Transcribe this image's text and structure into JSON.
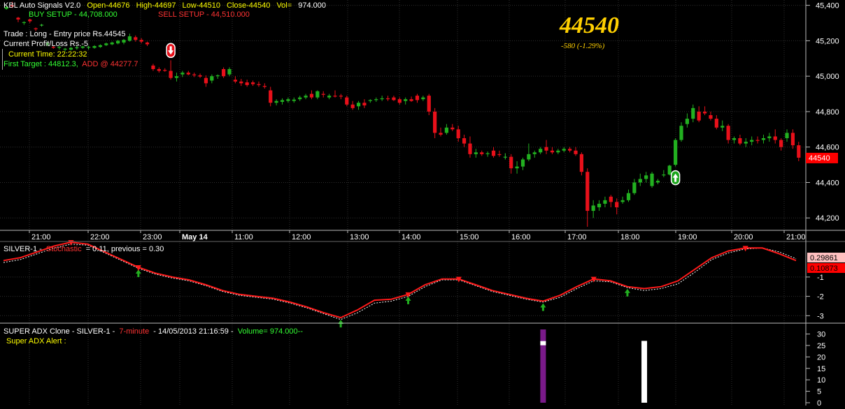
{
  "colors": {
    "background": "#000000",
    "grid": "#2e2e2e",
    "up": "#22b020",
    "down": "#e8101a",
    "doji": "#33cc33",
    "signal_line": "#ff1a1a",
    "stoch_dotted": "#ffffff",
    "title_white": "#ffffff",
    "open_yellow": "#ffff00",
    "buy_green": "#33ff33",
    "sell_red": "#ff3333",
    "big_price": "#ffd000",
    "change_text": "#ffd000",
    "last_price_box": "#ff0000",
    "adx_bar_purple": "#7a1a8a",
    "adx_bar_white": "#ffffff"
  },
  "price_panel": {
    "title": "KBL Auto Signals V2.0",
    "open": "Open-44676",
    "high": "High-44697",
    "low": "Low-44510",
    "close": "Close-44540",
    "vol": "Vol=",
    "vol_value": "974.000",
    "buy_setup": "BUY SETUP - 44,708.000",
    "sell_setup": "SELL SETUP - 44,510.000",
    "trade": "Trade : Long - Entry price Rs.44545",
    "pnl": "Current Profit/Loss Rs.-5",
    "current_time": "Current Time: 22:22:32",
    "first_target": "First Target : 44812.3,",
    "add": "ADD @ 44277.7",
    "big_price": "44540",
    "change": "-580  (-1.29%)",
    "last_price_box": "44540"
  },
  "time_axis": {
    "labels": [
      "21:00",
      "22:00",
      "23:00",
      "May 14",
      "11:00",
      "12:00",
      "13:00",
      "14:00",
      "15:00",
      "16:00",
      "17:00",
      "18:00",
      "19:00",
      "20:00",
      "21:00"
    ]
  },
  "stoch_panel": {
    "prefix": "SILVER-1 -",
    "name": "Stochastic",
    "value_text": "= 0.11, previous = 0.30",
    "box_1": "0.29861",
    "box_2": "0.10873"
  },
  "adx_panel": {
    "prefix": "SUPER ADX Clone - SILVER-1 -",
    "interval": "7-minute",
    "datetime": "- 14/05/2013 21:16:59 -",
    "volume": "Volume=  974.000--",
    "alert": "Super ADX Alert :"
  },
  "chart_data": [
    {
      "type": "candlestick",
      "title": "KBL Auto Signals V2.0",
      "y_axis_labels": [
        "45,400",
        "45,200",
        "45,000",
        "44,800",
        "44,600",
        "44,400",
        "44,200"
      ],
      "y_ticks": [
        45400,
        45200,
        45000,
        44800,
        44600,
        44400,
        44200
      ],
      "ylim": [
        44130,
        45430
      ],
      "grid": true,
      "x_labels": [
        "21:00",
        "22:00",
        "23:00",
        "May 14",
        "11:00",
        "12:00",
        "13:00",
        "14:00",
        "15:00",
        "16:00",
        "17:00",
        "18:00",
        "19:00",
        "20:00",
        "21:00"
      ],
      "ohlc": [
        [
          45380,
          45400,
          45375,
          45390
        ],
        [
          45400,
          45420,
          45385,
          45395
        ],
        [
          45330,
          45335,
          45305,
          45320
        ],
        [
          45300,
          45310,
          45290,
          45305
        ],
        [
          45320,
          45325,
          45300,
          45310
        ],
        [
          45270,
          45275,
          45255,
          45265
        ],
        [
          45290,
          45295,
          45280,
          45288
        ],
        [
          45180,
          45195,
          45170,
          45185
        ],
        [
          45165,
          45170,
          45155,
          45160
        ],
        [
          45160,
          45170,
          45150,
          45165
        ],
        [
          45150,
          45160,
          45140,
          45155
        ],
        [
          45150,
          45165,
          45145,
          45160
        ],
        [
          45160,
          45170,
          45150,
          45162
        ],
        [
          45160,
          45172,
          45155,
          45168
        ],
        [
          45162,
          45172,
          45150,
          45165
        ],
        [
          45160,
          45175,
          45155,
          45170
        ],
        [
          45165,
          45180,
          45160,
          45175
        ],
        [
          45175,
          45190,
          45170,
          45185
        ],
        [
          45180,
          45195,
          45175,
          45190
        ],
        [
          45185,
          45205,
          45180,
          45200
        ],
        [
          45190,
          45210,
          45180,
          45205
        ],
        [
          45200,
          45240,
          45195,
          45225
        ],
        [
          45220,
          45230,
          45195,
          45205
        ],
        [
          45205,
          45215,
          45185,
          45195
        ],
        [
          45190,
          45195,
          45170,
          45180
        ],
        [
          45060,
          45070,
          45030,
          45040
        ],
        [
          45040,
          45050,
          45020,
          45030
        ],
        [
          45035,
          45045,
          45025,
          45030
        ],
        [
          45030,
          45090,
          44980,
          44990
        ],
        [
          44990,
          45020,
          44970,
          45000
        ],
        [
          45010,
          45030,
          44995,
          45020
        ],
        [
          45020,
          45030,
          45005,
          45010
        ],
        [
          45010,
          45020,
          44995,
          45005
        ],
        [
          45005,
          45015,
          44990,
          44998
        ],
        [
          44990,
          45005,
          44940,
          44960
        ],
        [
          44975,
          45010,
          44960,
          45000
        ],
        [
          45000,
          45010,
          44985,
          45005
        ],
        [
          45040,
          45050,
          44990,
          45000
        ],
        [
          45010,
          45050,
          45000,
          45040
        ],
        [
          44980,
          45000,
          44960,
          44970
        ],
        [
          44970,
          44985,
          44945,
          44960
        ],
        [
          44965,
          44980,
          44940,
          44950
        ],
        [
          44965,
          44975,
          44945,
          44955
        ],
        [
          44955,
          44970,
          44940,
          44950
        ],
        [
          44945,
          44960,
          44930,
          44940
        ],
        [
          44920,
          44940,
          44830,
          44850
        ],
        [
          44850,
          44870,
          44835,
          44860
        ],
        [
          44855,
          44875,
          44840,
          44865
        ],
        [
          44860,
          44880,
          44850,
          44870
        ],
        [
          44860,
          44880,
          44850,
          44868
        ],
        [
          44870,
          44890,
          44860,
          44880
        ],
        [
          44880,
          44900,
          44870,
          44890
        ],
        [
          44900,
          44920,
          44870,
          44880
        ],
        [
          44880,
          44920,
          44870,
          44915
        ],
        [
          44900,
          44915,
          44880,
          44895
        ],
        [
          44880,
          44900,
          44870,
          44890
        ],
        [
          44890,
          44920,
          44880,
          44885
        ],
        [
          44890,
          44900,
          44870,
          44885
        ],
        [
          44880,
          44890,
          44830,
          44840
        ],
        [
          44840,
          44860,
          44810,
          44820
        ],
        [
          44830,
          44860,
          44810,
          44850
        ],
        [
          44850,
          44870,
          44820,
          44835
        ],
        [
          44860,
          44870,
          44850,
          44865
        ],
        [
          44865,
          44880,
          44855,
          44870
        ],
        [
          44870,
          44890,
          44860,
          44875
        ],
        [
          44875,
          44890,
          44860,
          44870
        ],
        [
          44880,
          44890,
          44860,
          44865
        ],
        [
          44870,
          44880,
          44840,
          44850
        ],
        [
          44860,
          44880,
          44840,
          44870
        ],
        [
          44870,
          44885,
          44855,
          44860
        ],
        [
          44890,
          44900,
          44850,
          44865
        ],
        [
          44870,
          44890,
          44860,
          44880
        ],
        [
          44890,
          44900,
          44780,
          44800
        ],
        [
          44800,
          44820,
          44650,
          44680
        ],
        [
          44680,
          44710,
          44660,
          44670
        ],
        [
          44680,
          44730,
          44670,
          44710
        ],
        [
          44710,
          44730,
          44690,
          44700
        ],
        [
          44700,
          44720,
          44630,
          44650
        ],
        [
          44650,
          44670,
          44600,
          44620
        ],
        [
          44620,
          44660,
          44540,
          44560
        ],
        [
          44560,
          44590,
          44540,
          44570
        ],
        [
          44570,
          44580,
          44550,
          44560
        ],
        [
          44560,
          44575,
          44545,
          44565
        ],
        [
          44580,
          44600,
          44540,
          44550
        ],
        [
          44560,
          44580,
          44545,
          44555
        ],
        [
          44545,
          44565,
          44530,
          44545
        ],
        [
          44545,
          44560,
          44450,
          44480
        ],
        [
          44480,
          44520,
          44450,
          44490
        ],
        [
          44490,
          44540,
          44470,
          44530
        ],
        [
          44530,
          44620,
          44520,
          44560
        ],
        [
          44560,
          44580,
          44540,
          44570
        ],
        [
          44570,
          44600,
          44560,
          44590
        ],
        [
          44600,
          44640,
          44560,
          44580
        ],
        [
          44580,
          44600,
          44560,
          44570
        ],
        [
          44570,
          44590,
          44560,
          44580
        ],
        [
          44580,
          44600,
          44570,
          44590
        ],
        [
          44590,
          44600,
          44570,
          44580
        ],
        [
          44580,
          44600,
          44550,
          44560
        ],
        [
          44560,
          44570,
          44440,
          44460
        ],
        [
          44460,
          44480,
          44150,
          44240
        ],
        [
          44240,
          44300,
          44200,
          44270
        ],
        [
          44260,
          44300,
          44240,
          44280
        ],
        [
          44280,
          44320,
          44260,
          44300
        ],
        [
          44320,
          44330,
          44260,
          44290
        ],
        [
          44290,
          44310,
          44220,
          44260
        ],
        [
          44290,
          44320,
          44280,
          44300
        ],
        [
          44300,
          44360,
          44290,
          44340
        ],
        [
          44340,
          44420,
          44330,
          44400
        ],
        [
          44400,
          44450,
          44380,
          44420
        ],
        [
          44420,
          44460,
          44400,
          44440
        ],
        [
          44380,
          44460,
          44370,
          44450
        ],
        [
          44400,
          44420,
          44390,
          44410
        ],
        [
          44440,
          44470,
          44430,
          44445
        ],
        [
          44445,
          44500,
          44440,
          44495
        ],
        [
          44500,
          44650,
          44490,
          44640
        ],
        [
          44640,
          44740,
          44630,
          44720
        ],
        [
          44730,
          44790,
          44710,
          44760
        ],
        [
          44760,
          44840,
          44740,
          44820
        ],
        [
          44800,
          44830,
          44740,
          44750
        ],
        [
          44800,
          44830,
          44780,
          44790
        ],
        [
          44780,
          44800,
          44750,
          44760
        ],
        [
          44760,
          44780,
          44700,
          44710
        ],
        [
          44710,
          44750,
          44690,
          44720
        ],
        [
          44720,
          44730,
          44620,
          44640
        ],
        [
          44640,
          44660,
          44620,
          44650
        ],
        [
          44650,
          44670,
          44610,
          44620
        ],
        [
          44620,
          44650,
          44600,
          44630
        ],
        [
          44630,
          44660,
          44610,
          44640
        ],
        [
          44640,
          44660,
          44620,
          44635
        ],
        [
          44640,
          44670,
          44620,
          44650
        ],
        [
          44650,
          44680,
          44630,
          44660
        ],
        [
          44660,
          44700,
          44620,
          44640
        ],
        [
          44640,
          44650,
          44580,
          44600
        ],
        [
          44650,
          44700,
          44630,
          44680
        ],
        [
          44680,
          44700,
          44590,
          44610
        ],
        [
          44610,
          44630,
          44520,
          44540
        ]
      ],
      "signal_arrows": [
        {
          "direction": "down",
          "index": 28
        },
        {
          "direction": "up",
          "index": 114
        }
      ]
    },
    {
      "type": "line",
      "title": "Stochastic",
      "y_axis_labels": [
        "-1",
        "-2",
        "-3"
      ],
      "y_ticks": [
        -1,
        -2,
        -3
      ],
      "ylim": [
        -3.35,
        0.8
      ],
      "series": [
        {
          "values": [
            -0.15,
            0.0,
            0.3,
            0.6,
            0.8,
            0.7,
            0.3,
            -0.1,
            -0.5,
            -0.8,
            -1.0,
            -1.15,
            -1.4,
            -1.7,
            -1.9,
            -2.0,
            -2.1,
            -2.3,
            -2.55,
            -2.85,
            -3.1,
            -2.7,
            -2.2,
            -2.15,
            -1.9,
            -1.4,
            -1.1,
            -1.1,
            -1.4,
            -1.7,
            -1.9,
            -2.1,
            -2.25,
            -1.95,
            -1.5,
            -1.1,
            -1.2,
            -1.5,
            -1.6,
            -1.5,
            -1.2,
            -0.6,
            0.0,
            0.35,
            0.5,
            0.5,
            0.2,
            -0.15
          ]
        },
        {
          "values": [
            -0.25,
            -0.1,
            0.2,
            0.5,
            0.7,
            0.65,
            0.25,
            -0.15,
            -0.55,
            -0.85,
            -1.05,
            -1.2,
            -1.45,
            -1.75,
            -1.95,
            -2.05,
            -2.15,
            -2.35,
            -2.6,
            -2.9,
            -3.2,
            -2.85,
            -2.35,
            -2.25,
            -2.0,
            -1.5,
            -1.15,
            -1.15,
            -1.45,
            -1.75,
            -1.95,
            -2.15,
            -2.3,
            -2.05,
            -1.6,
            -1.2,
            -1.25,
            -1.55,
            -1.7,
            -1.6,
            -1.35,
            -0.75,
            -0.1,
            0.25,
            0.45,
            0.5,
            0.3,
            -0.05
          ]
        }
      ],
      "signal_arrows": [
        {
          "direction": "down",
          "index": 4
        },
        {
          "direction": "up",
          "index": 8
        },
        {
          "direction": "down",
          "index": 8
        },
        {
          "direction": "up",
          "index": 20
        },
        {
          "direction": "down",
          "index": 24
        },
        {
          "direction": "up",
          "index": 24
        },
        {
          "direction": "down",
          "index": 27
        },
        {
          "direction": "up",
          "index": 32
        },
        {
          "direction": "down",
          "index": 35
        },
        {
          "direction": "up",
          "index": 37
        },
        {
          "direction": "down",
          "index": 44
        }
      ]
    },
    {
      "type": "bar",
      "title": "SUPER ADX Clone",
      "y_axis_labels": [
        "30",
        "25",
        "20",
        "15",
        "10",
        "5",
        "0"
      ],
      "y_ticks": [
        30,
        25,
        20,
        15,
        10,
        5,
        0
      ],
      "ylim": [
        0,
        32
      ],
      "bars": [
        {
          "index": 32,
          "value": 32,
          "color": "purple",
          "marker_value": 26
        },
        {
          "index": 38,
          "value": 27,
          "color": "white"
        }
      ]
    }
  ]
}
